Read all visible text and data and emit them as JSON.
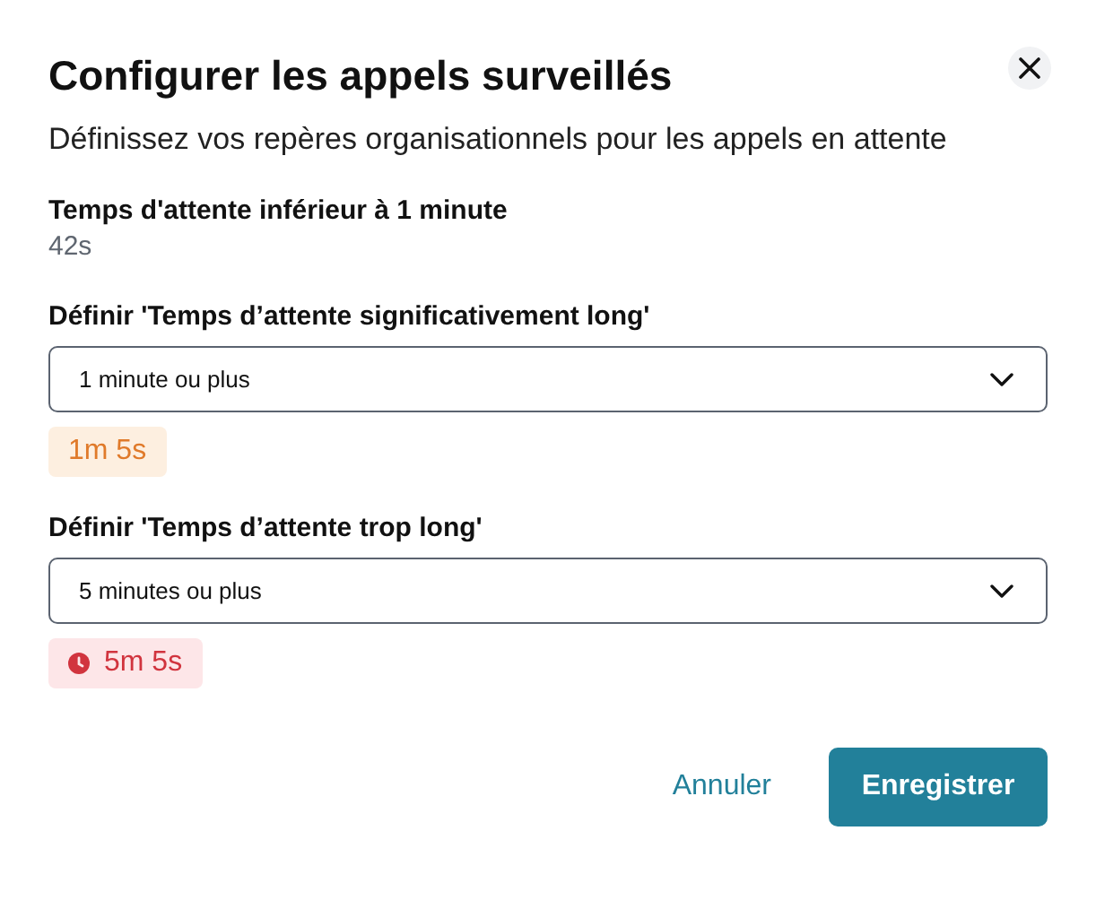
{
  "dialog": {
    "title": "Configurer les appels surveillés",
    "subtitle": "Définissez vos repères organisationnels pour les appels en attente"
  },
  "current": {
    "label": "Temps d'attente inférieur à 1 minute",
    "value": "42s"
  },
  "thresholds": [
    {
      "label": "Définir 'Temps d’attente significativement long'",
      "value": "1 minute ou plus",
      "badge": {
        "kind": "warning",
        "text": "1m 5s"
      }
    },
    {
      "label": "Définir 'Temps d’attente trop long'",
      "value": "5 minutes ou plus",
      "badge": {
        "kind": "danger",
        "text": "5m 5s"
      }
    }
  ],
  "buttons": {
    "cancel": "Annuler",
    "save": "Enregistrer"
  }
}
